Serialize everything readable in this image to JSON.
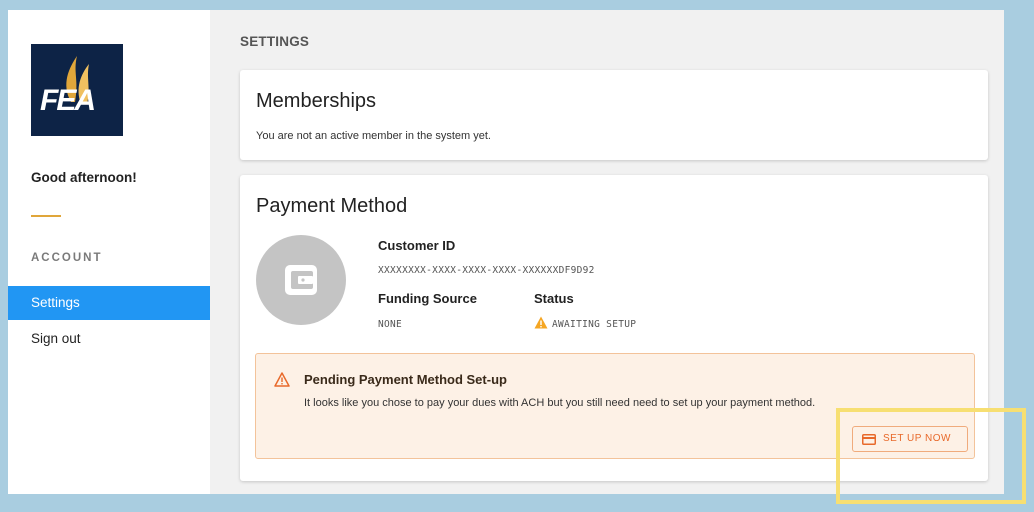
{
  "sidebar": {
    "logo_text": "FEA",
    "greeting": "Good afternoon!",
    "section_label": "ACCOUNT",
    "items": [
      {
        "label": "Settings",
        "active": true
      },
      {
        "label": "Sign out",
        "active": false
      }
    ]
  },
  "main": {
    "page_title": "SETTINGS",
    "memberships": {
      "title": "Memberships",
      "text": "You are not an active member in the system yet."
    },
    "payment": {
      "title": "Payment Method",
      "customer_id_label": "Customer ID",
      "customer_id_value": "XXXXXXXX-XXXX-XXXX-XXXX-XXXXXXDF9D92",
      "funding_label": "Funding Source",
      "funding_value": "NONE",
      "status_label": "Status",
      "status_value": "AWAITING SETUP",
      "alert": {
        "title": "Pending Payment Method Set-up",
        "text": "It looks like you chose to pay your dues with ACH but you still need need to set up your payment method.",
        "button_label": "SET UP NOW"
      }
    }
  },
  "icons": {
    "wallet": "wallet-icon",
    "warning": "warning-icon",
    "credit_card": "credit-card-icon"
  },
  "colors": {
    "accent": "#2196f3",
    "gold": "#e0a63a",
    "warning": "#f5a623",
    "alert_bg": "#fdf1e6",
    "button_text": "#e8692a",
    "highlight": "#f7df72",
    "logo_bg": "#0d2346"
  }
}
